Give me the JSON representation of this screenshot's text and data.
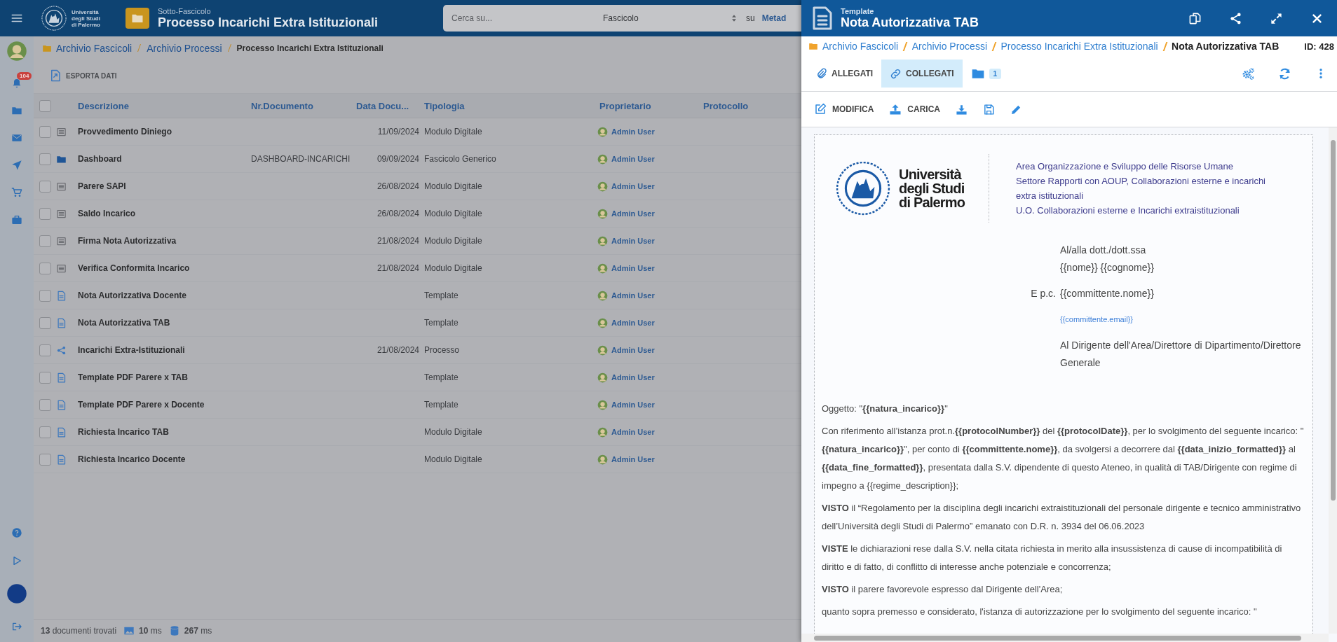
{
  "app_header": {
    "logo_lines": [
      "Università",
      "degli Studi",
      "di Palermo"
    ],
    "subtitle": "Sotto-Fascicolo",
    "title": "Processo Incarichi Extra Istituzionali",
    "search": {
      "placeholder": "Cerca su...",
      "scope": "Fascicolo",
      "on_label": "su",
      "target": "Metad"
    }
  },
  "sidebar": {
    "top": [
      {
        "kind": "avatar"
      },
      {
        "kind": "bell",
        "badge": "104"
      },
      {
        "kind": "folder"
      },
      {
        "kind": "envelope"
      },
      {
        "kind": "plane"
      },
      {
        "kind": "cart"
      },
      {
        "kind": "briefcase"
      }
    ],
    "bottom": [
      {
        "kind": "question"
      },
      {
        "kind": "play"
      },
      {
        "kind": "dot"
      },
      {
        "kind": "signout"
      }
    ]
  },
  "breadcrumb": [
    "Archivio Fascicoli",
    "Archivio Processi",
    "Processo Incarichi Extra Istituzionali"
  ],
  "export_button": "ESPORTA DATI",
  "table": {
    "select_all_checked": false,
    "columns": [
      "Descrizione",
      "Nr.Documento",
      "Data Docu...",
      "Tipologia",
      "Proprietario",
      "Protocollo"
    ],
    "rows": [
      {
        "kind": "form",
        "checked": false,
        "description": "Provvedimento Diniego",
        "date": "11/09/2024",
        "type": "Modulo Digitale",
        "owner": "Admin User"
      },
      {
        "kind": "folder",
        "checked": false,
        "description": "Dashboard",
        "number": "DASHBOARD-INCARICHI",
        "date": "09/09/2024",
        "type": "Fascicolo Generico",
        "owner": "Admin User"
      },
      {
        "kind": "form",
        "checked": false,
        "description": "Parere SAPI",
        "date": "26/08/2024",
        "type": "Modulo Digitale",
        "owner": "Admin User"
      },
      {
        "kind": "form",
        "checked": false,
        "description": "Saldo Incarico",
        "date": "26/08/2024",
        "type": "Modulo Digitale",
        "owner": "Admin User"
      },
      {
        "kind": "form",
        "checked": false,
        "description": "Firma Nota Autorizzativa",
        "date": "21/08/2024",
        "type": "Modulo Digitale",
        "owner": "Admin User"
      },
      {
        "kind": "form",
        "checked": false,
        "description": "Verifica Conformita Incarico",
        "date": "21/08/2024",
        "type": "Modulo Digitale",
        "owner": "Admin User"
      },
      {
        "kind": "template",
        "checked": false,
        "description": "Nota Autorizzativa Docente",
        "type": "Template",
        "owner": "Admin User"
      },
      {
        "kind": "template",
        "checked": false,
        "description": "Nota Autorizzativa TAB",
        "type": "Template",
        "owner": "Admin User"
      },
      {
        "kind": "process",
        "checked": false,
        "description": "Incarichi Extra-Istituzionali",
        "date": "21/08/2024",
        "type": "Processo",
        "owner": "Admin User"
      },
      {
        "kind": "template",
        "checked": false,
        "description": "Template PDF Parere x TAB",
        "type": "Template",
        "owner": "Admin User"
      },
      {
        "kind": "template",
        "checked": false,
        "description": "Template PDF Parere x Docente",
        "type": "Template",
        "owner": "Admin User"
      },
      {
        "kind": "template",
        "checked": false,
        "description": "Richiesta Incarico TAB",
        "type": "Modulo Digitale",
        "owner": "Admin User"
      },
      {
        "kind": "template",
        "checked": false,
        "description": "Richiesta Incarico Docente",
        "type": "Modulo Digitale",
        "owner": "Admin User"
      }
    ]
  },
  "status_bar": [
    {
      "kind": "count",
      "text": "**13** documenti trovati"
    },
    {
      "kind": "image",
      "text": "**10** ms"
    },
    {
      "kind": "database",
      "text": "**267** ms"
    }
  ],
  "drawer": {
    "subtitle": "Template",
    "title": "Nota Autorizzativa TAB",
    "header_actions": [
      {
        "kind": "copy"
      },
      {
        "kind": "share"
      },
      {
        "kind": "expand"
      },
      {
        "kind": "close"
      }
    ],
    "breadcrumb": [
      "Archivio Fascicoli",
      "Archivio Processi",
      "Processo Incarichi Extra Istituzionali",
      "Nota Autorizzativa TAB"
    ],
    "id_label": "ID: 428",
    "tabs": [
      {
        "kind": "paperclip",
        "label": "ALLEGATI",
        "selected": false
      },
      {
        "kind": "link",
        "label": "COLLEGATI",
        "selected": true
      },
      {
        "kind": "folder",
        "badge": "1",
        "selected": false
      }
    ],
    "tab_actions": [
      {
        "kind": "gears"
      },
      {
        "kind": "refresh"
      },
      {
        "kind": "kebab"
      }
    ],
    "toolbar": [
      {
        "kind": "edit",
        "label": "MODIFICA"
      },
      {
        "kind": "upload",
        "label": "CARICA"
      },
      {
        "kind": "download"
      },
      {
        "kind": "save"
      },
      {
        "kind": "pencil"
      }
    ],
    "document": {
      "logo_lines": [
        "Università",
        "degli Studi",
        "di Palermo"
      ],
      "office_lines": [
        "Area Organizzazione e Sviluppo delle Risorse Umane",
        "Settore Rapporti con AOUP, Collaborazioni esterne e incarichi extra istituzionali",
        "U.O. Collaborazioni esterne e Incarichi extraistituzionali"
      ],
      "recipients": [
        {
          "kind": "text",
          "lines": [
            "Al/alla dott./dott.ssa",
            "{{nome}} {{cognome}}"
          ]
        },
        {
          "kind": "text",
          "label": "E p.c.",
          "lines": [
            "{{committente.nome}}"
          ]
        },
        {
          "kind": "link",
          "lines": [
            "{{committente.email}}"
          ]
        },
        {
          "kind": "text",
          "lines": [
            "Al Dirigente dell'Area/Direttore di Dipartimento/Direttore Generale"
          ]
        }
      ],
      "paragraphs": [
        "Oggetto: \"**{{natura_incarico}}**\"",
        "Con riferimento all’istanza prot.n.**{{protocolNumber}}** del **{{protocolDate}}**, per lo svolgimento del seguente incarico: \"**{{natura_incarico}}**\", per conto di **{{committente.nome}}**, da svolgersi a decorrere dal **{{data_inizio_formatted}}** al **{{data_fine_formatted}}**, presentata dalla S.V. dipendente di questo Ateneo, in qualità di TAB/Dirigente con regime di impegno a {{regime_description}};",
        "**VISTO** il “Regolamento per la disciplina degli incarichi extraistituzionali del personale dirigente e tecnico amministrativo dell’Università degli Studi di Palermo” emanato con D.R. n. 3934 del 06.06.2023",
        "**VISTE** le dichiarazioni rese dalla S.V. nella citata richiesta in merito alla insussistenza di cause di incompatibilità di diritto e di fatto, di conflitto di interesse anche potenziale e concorrenza;",
        "**VISTO** il parere favorevole espresso dal Dirigente dell'Area;",
        "quanto sopra premesso e considerato, l'istanza di autorizzazione per lo svolgimento del seguente incarico: \""
      ]
    }
  }
}
